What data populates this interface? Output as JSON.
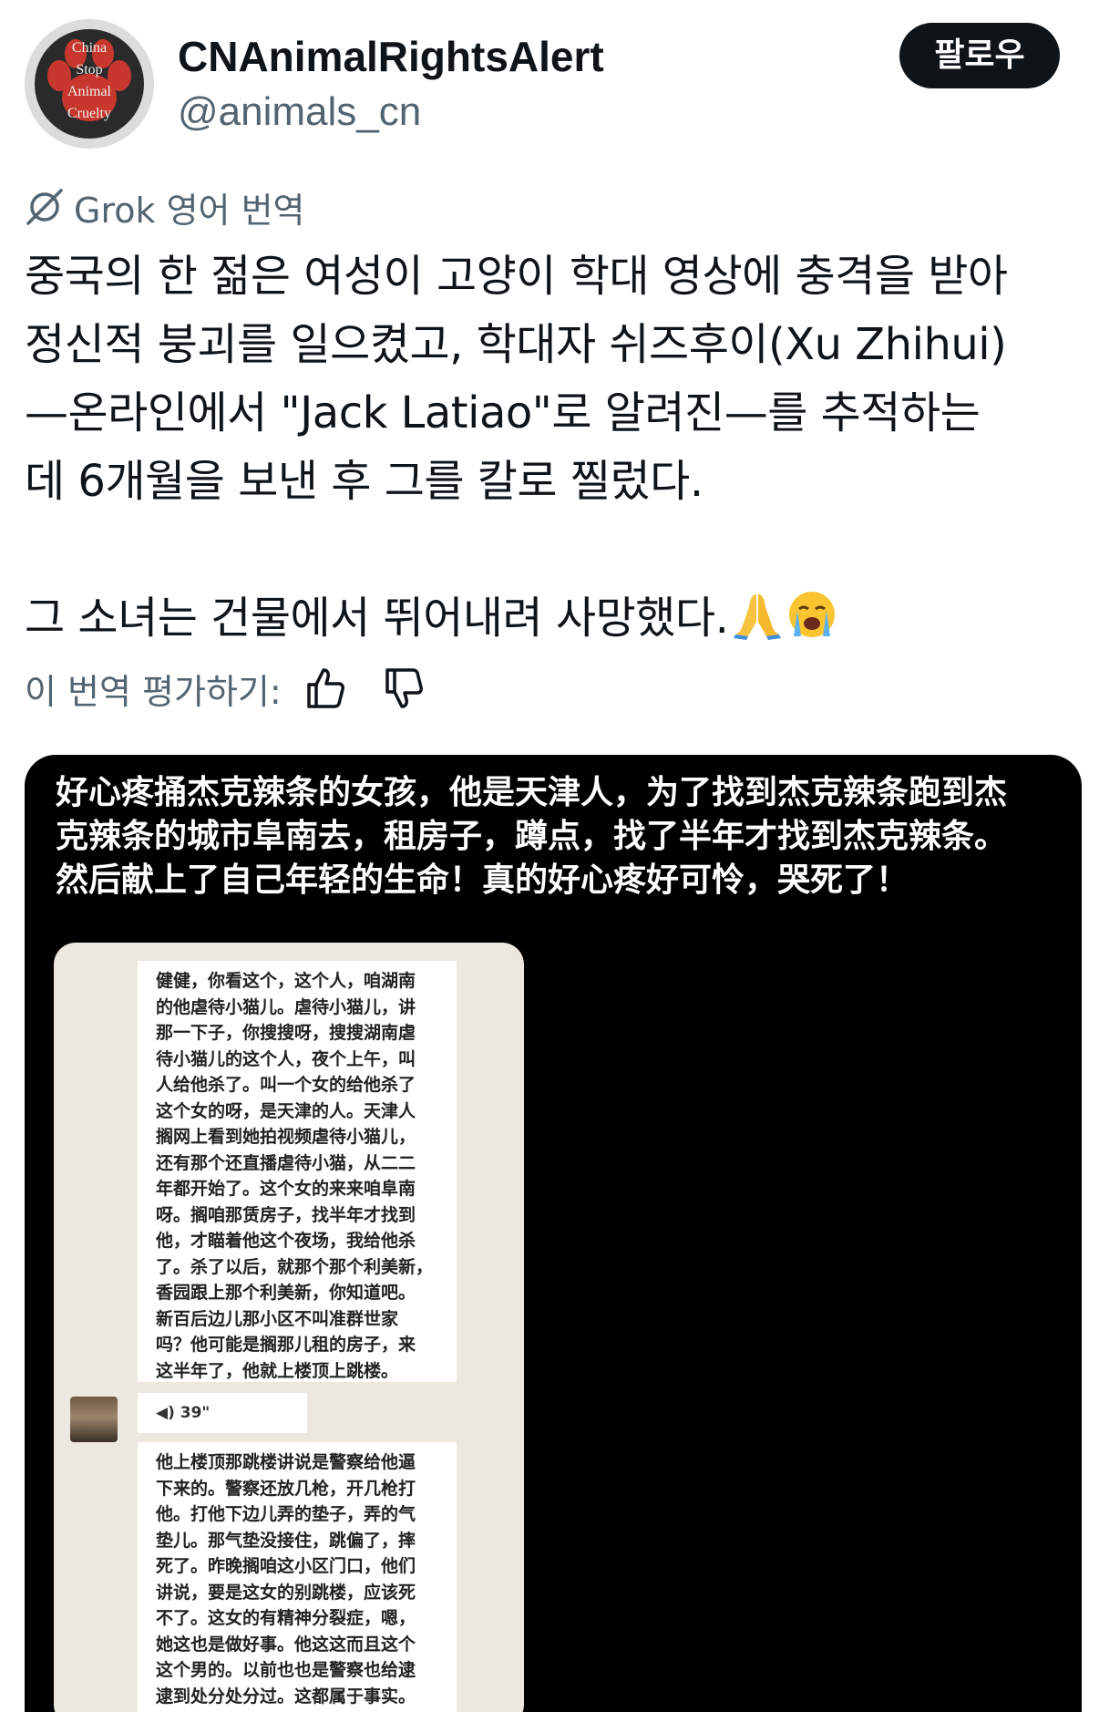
{
  "account": {
    "display_name": "CNAnimalRightsAlert",
    "handle": "@animals_cn",
    "avatar_text": [
      "China",
      "Stop",
      "Animal",
      "Cruelty"
    ]
  },
  "follow_button": {
    "label": "팔로우"
  },
  "translation": {
    "label": "Grok 영어 번역",
    "icon": "grok-icon"
  },
  "post": {
    "lines": [
      "중국의 한 젊은 여성이 고양이 학대 영상에 충격을 받아",
      "정신적 붕괴를 일으켰고, 학대자 쉬즈후이(Xu Zhihui)",
      "—온라인에서 \"Jack Latiao\"로 알려진—를 추적하는",
      "데 6개월을 보낸 후 그를 칼로 찔렀다."
    ],
    "second_paragraph": "그 소녀는 건물에서 뛰어내려 사망했다.",
    "emojis": [
      "folded-hands-emoji",
      "loudly-crying-face-emoji"
    ]
  },
  "rating": {
    "label": "이 번역 평가하기:",
    "up_icon": "thumbs-up-icon",
    "down_icon": "thumbs-down-icon"
  },
  "media": {
    "caption_lines": [
      "好心疼捅杰克辣条的女孩，他是天津人，为了找到杰克辣条跑到杰",
      "克辣条的城市阜南去，租房子，蹲点，找了半年才找到杰克辣条。",
      "然后献上了自己年轻的生命！真的好心疼好可怜，哭死了！"
    ],
    "chat": {
      "message_1": [
        "健健，你看这个，这个人，咱湖南",
        "的他虐待小猫儿。虐待小猫儿，讲",
        "那一下子，你搜搜呀，搜搜湖南虐",
        "待小猫儿的这个人，夜个上午，叫",
        "人给他杀了。叫一个女的给他杀了",
        "这个女的呀，是天津的人。天津人",
        "搁网上看到她拍视频虐待小猫儿，",
        "还有那个还直播虐待小猫，从二二",
        "年都开始了。这个女的来来咱阜南",
        "呀。搁咱那赁房子，找半年才找到",
        "他，才瞄着他这个夜场，我给他杀",
        "了。杀了以后，就那个那个利美新，",
        "香园跟上那个利美新，你知道吧。",
        "新百后边儿那小区不叫准群世家",
        "吗？他可能是搁那儿租的房子，来",
        "这半年了，他就上楼顶上跳楼。"
      ],
      "voice_label": "39\"",
      "message_2": [
        "他上楼顶那跳楼讲说是警察给他逼",
        "下来的。警察还放几枪，开几枪打",
        "他。打他下边儿弄的垫子，弄的气",
        "垫儿。那气垫没接住，跳偏了，摔",
        "死了。昨晚搁咱这小区门口，他们",
        "讲说，要是这女的别跳楼，应该死",
        "不了。这女的有精神分裂症，嗯，",
        "她这也是做好事。他这这而且这个",
        "这个男的。以前也也是警察也给逮",
        "逮到处分处分过。这都属于事实。"
      ]
    }
  },
  "colors": {
    "text_primary": "#0f1419",
    "text_secondary": "#536471",
    "button_bg": "#0f1419",
    "media_bg": "#000000",
    "chat_bg": "#ece8df"
  }
}
